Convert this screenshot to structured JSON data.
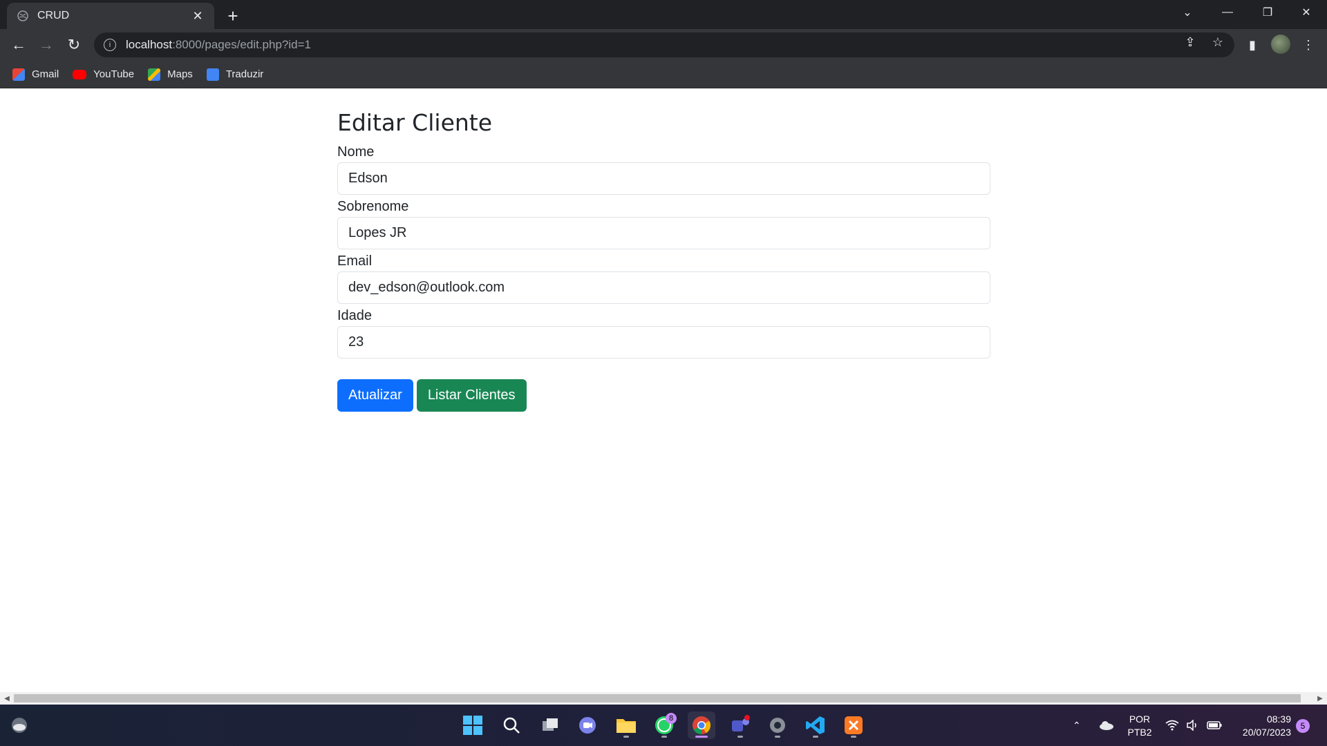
{
  "browser": {
    "tab_title": "CRUD",
    "new_tab_symbol": "+",
    "url_host": "localhost",
    "url_path": ":8000/pages/edit.php?id=1",
    "bookmarks": [
      {
        "label": "Gmail",
        "icon": "gmail-icon",
        "color": "#ea4335"
      },
      {
        "label": "YouTube",
        "icon": "youtube-icon",
        "color": "#ff0000"
      },
      {
        "label": "Maps",
        "icon": "maps-icon",
        "color": "#34a853"
      },
      {
        "label": "Traduzir",
        "icon": "translate-icon",
        "color": "#4285f4"
      }
    ]
  },
  "page": {
    "title": "Editar Cliente",
    "fields": [
      {
        "label": "Nome",
        "value": "Edson"
      },
      {
        "label": "Sobrenome",
        "value": "Lopes JR"
      },
      {
        "label": "Email",
        "value": "dev_edson@outlook.com"
      },
      {
        "label": "Idade",
        "value": "23"
      }
    ],
    "buttons": {
      "update_label": "Atualizar",
      "list_label": "Listar Clientes"
    },
    "colors": {
      "primary": "#0d6efd",
      "success": "#198754"
    }
  },
  "taskbar": {
    "whatsapp_badge": "8",
    "language_line1": "POR",
    "language_line2": "PTB2",
    "time": "08:39",
    "date": "20/07/2023",
    "notification_count": "5"
  }
}
